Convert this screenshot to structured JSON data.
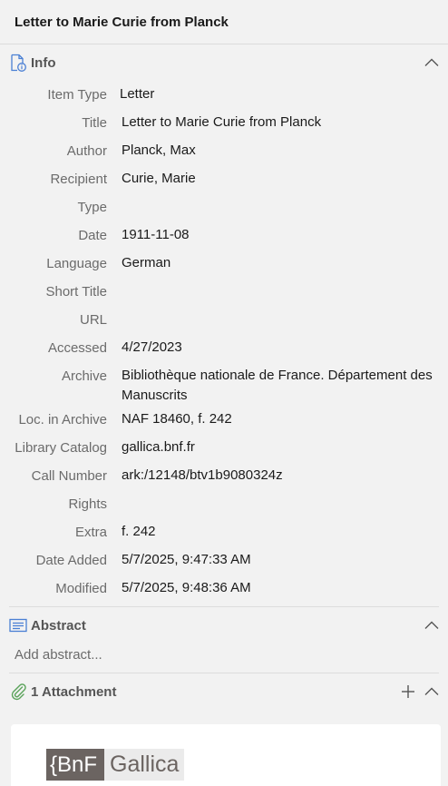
{
  "header": {
    "title": "Letter to Marie Curie from Planck"
  },
  "info": {
    "label": "Info",
    "fields": [
      {
        "label": "Item Type",
        "value": "Letter"
      },
      {
        "label": "Title",
        "value": "Letter to Marie Curie from Planck"
      },
      {
        "label": "Author",
        "value": "Planck, Max"
      },
      {
        "label": "Recipient",
        "value": "Curie, Marie"
      },
      {
        "label": "Type",
        "value": ""
      },
      {
        "label": "Date",
        "value": "1911-11-08"
      },
      {
        "label": "Language",
        "value": "German"
      },
      {
        "label": "Short Title",
        "value": ""
      },
      {
        "label": "URL",
        "value": ""
      },
      {
        "label": "Accessed",
        "value": "4/27/2023"
      },
      {
        "label": "Archive",
        "value": "Bibliothèque nationale de France. Département des Manuscrits"
      },
      {
        "label": "Loc. in Archive",
        "value": "NAF 18460, f. 242"
      },
      {
        "label": "Library Catalog",
        "value": "gallica.bnf.fr"
      },
      {
        "label": "Call Number",
        "value": "ark:/12148/btv1b9080324z"
      },
      {
        "label": "Rights",
        "value": ""
      },
      {
        "label": "Extra",
        "value": "f. 242"
      },
      {
        "label": "Date Added",
        "value": "5/7/2025, 9:47:33 AM"
      },
      {
        "label": "Modified",
        "value": "5/7/2025, 9:48:36 AM"
      }
    ]
  },
  "abstract": {
    "label": "Abstract",
    "placeholder": "Add abstract..."
  },
  "attachments": {
    "label": "1 Attachment",
    "logo": {
      "left": "{BnF",
      "right": "Gallica"
    }
  },
  "colors": {
    "background": "#f2f2f2",
    "label_gray": "#6b6b6b",
    "icon_blue": "#4a7fd4",
    "icon_green": "#5aa35a"
  }
}
